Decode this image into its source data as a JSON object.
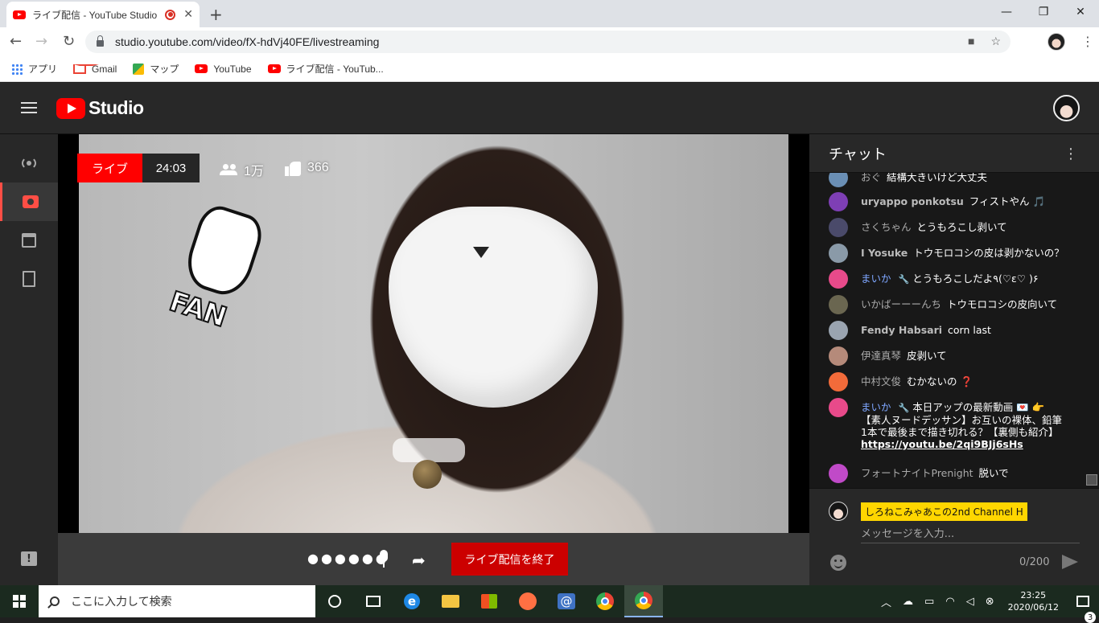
{
  "browser": {
    "tab_title": "ライブ配信 - YouTube Studio",
    "url": "studio.youtube.com/video/fX-hdVj40FE/livestreaming",
    "bookmarks": [
      {
        "label": "アプリ"
      },
      {
        "label": "Gmail"
      },
      {
        "label": "マップ"
      },
      {
        "label": "YouTube"
      },
      {
        "label": "ライブ配信 - YouTub..."
      }
    ],
    "window_controls": {
      "minimize": "—",
      "maximize": "❐",
      "close": "✕"
    }
  },
  "studio": {
    "logo_text": "Studio"
  },
  "stream": {
    "live_label": "ライブ",
    "elapsed": "24:03",
    "viewers": "1万",
    "likes": "366",
    "sticker_text": "FAN",
    "dots": "●●●●●●",
    "end_button": "ライブ配信を終了"
  },
  "chat": {
    "title": "チャット",
    "messages": [
      {
        "author": "おぐ",
        "text": "結構大きいけど大丈夫",
        "avatar_color": "#6a8fb5"
      },
      {
        "author": "uryappo ponkotsu",
        "text": "フィストやん 🎵",
        "avatar_color": "#7e3fb5",
        "bold": true
      },
      {
        "author": "さくちゃん",
        "text": "とうもろこし剥いて",
        "avatar_color": "#4a4a6a"
      },
      {
        "author": "I Yosuke",
        "text": "トウモロコシの皮は剥かないの？",
        "avatar_color": "#8a9aa8",
        "bold": true
      },
      {
        "author": "まいか",
        "text": "とうもろこしだよ٩(♡ε♡ )۶",
        "avatar_color": "#e84a8a",
        "owner": true
      },
      {
        "author": "いかばーーーんち",
        "text": "トウモロコシの皮向いて",
        "avatar_color": "#6a6650"
      },
      {
        "author": "Fendy Habsari",
        "text": "corn last",
        "avatar_color": "#9aa4b0",
        "bold": true
      },
      {
        "author": "伊達真琴",
        "text": "皮剥いて",
        "avatar_color": "#b58a7a"
      },
      {
        "author": "中村文俊",
        "text": "むかないの ❓",
        "avatar_color": "#f26b3a"
      },
      {
        "author": "まいか",
        "text": "本日アップの最新動画 💌 👉 【素人ヌードデッサン】お互いの裸体、鉛筆1本で最後まで描き切れる？【裏側も紹介】",
        "link": "https://youtu.be/2qi9BJj6sHs",
        "avatar_color": "#e84a8a",
        "owner": true
      },
      {
        "author": "フォートナイトPrenight",
        "text": "脱いで",
        "avatar_color": "#c04ac8"
      }
    ],
    "me_name": "しろねこみゃあこの2nd Channel H",
    "input_placeholder": "メッセージを入力...",
    "char_count": "0/200"
  },
  "taskbar": {
    "search_placeholder": "ここに入力して検索",
    "time": "23:25",
    "date": "2020/06/12",
    "notification_count": "3"
  }
}
